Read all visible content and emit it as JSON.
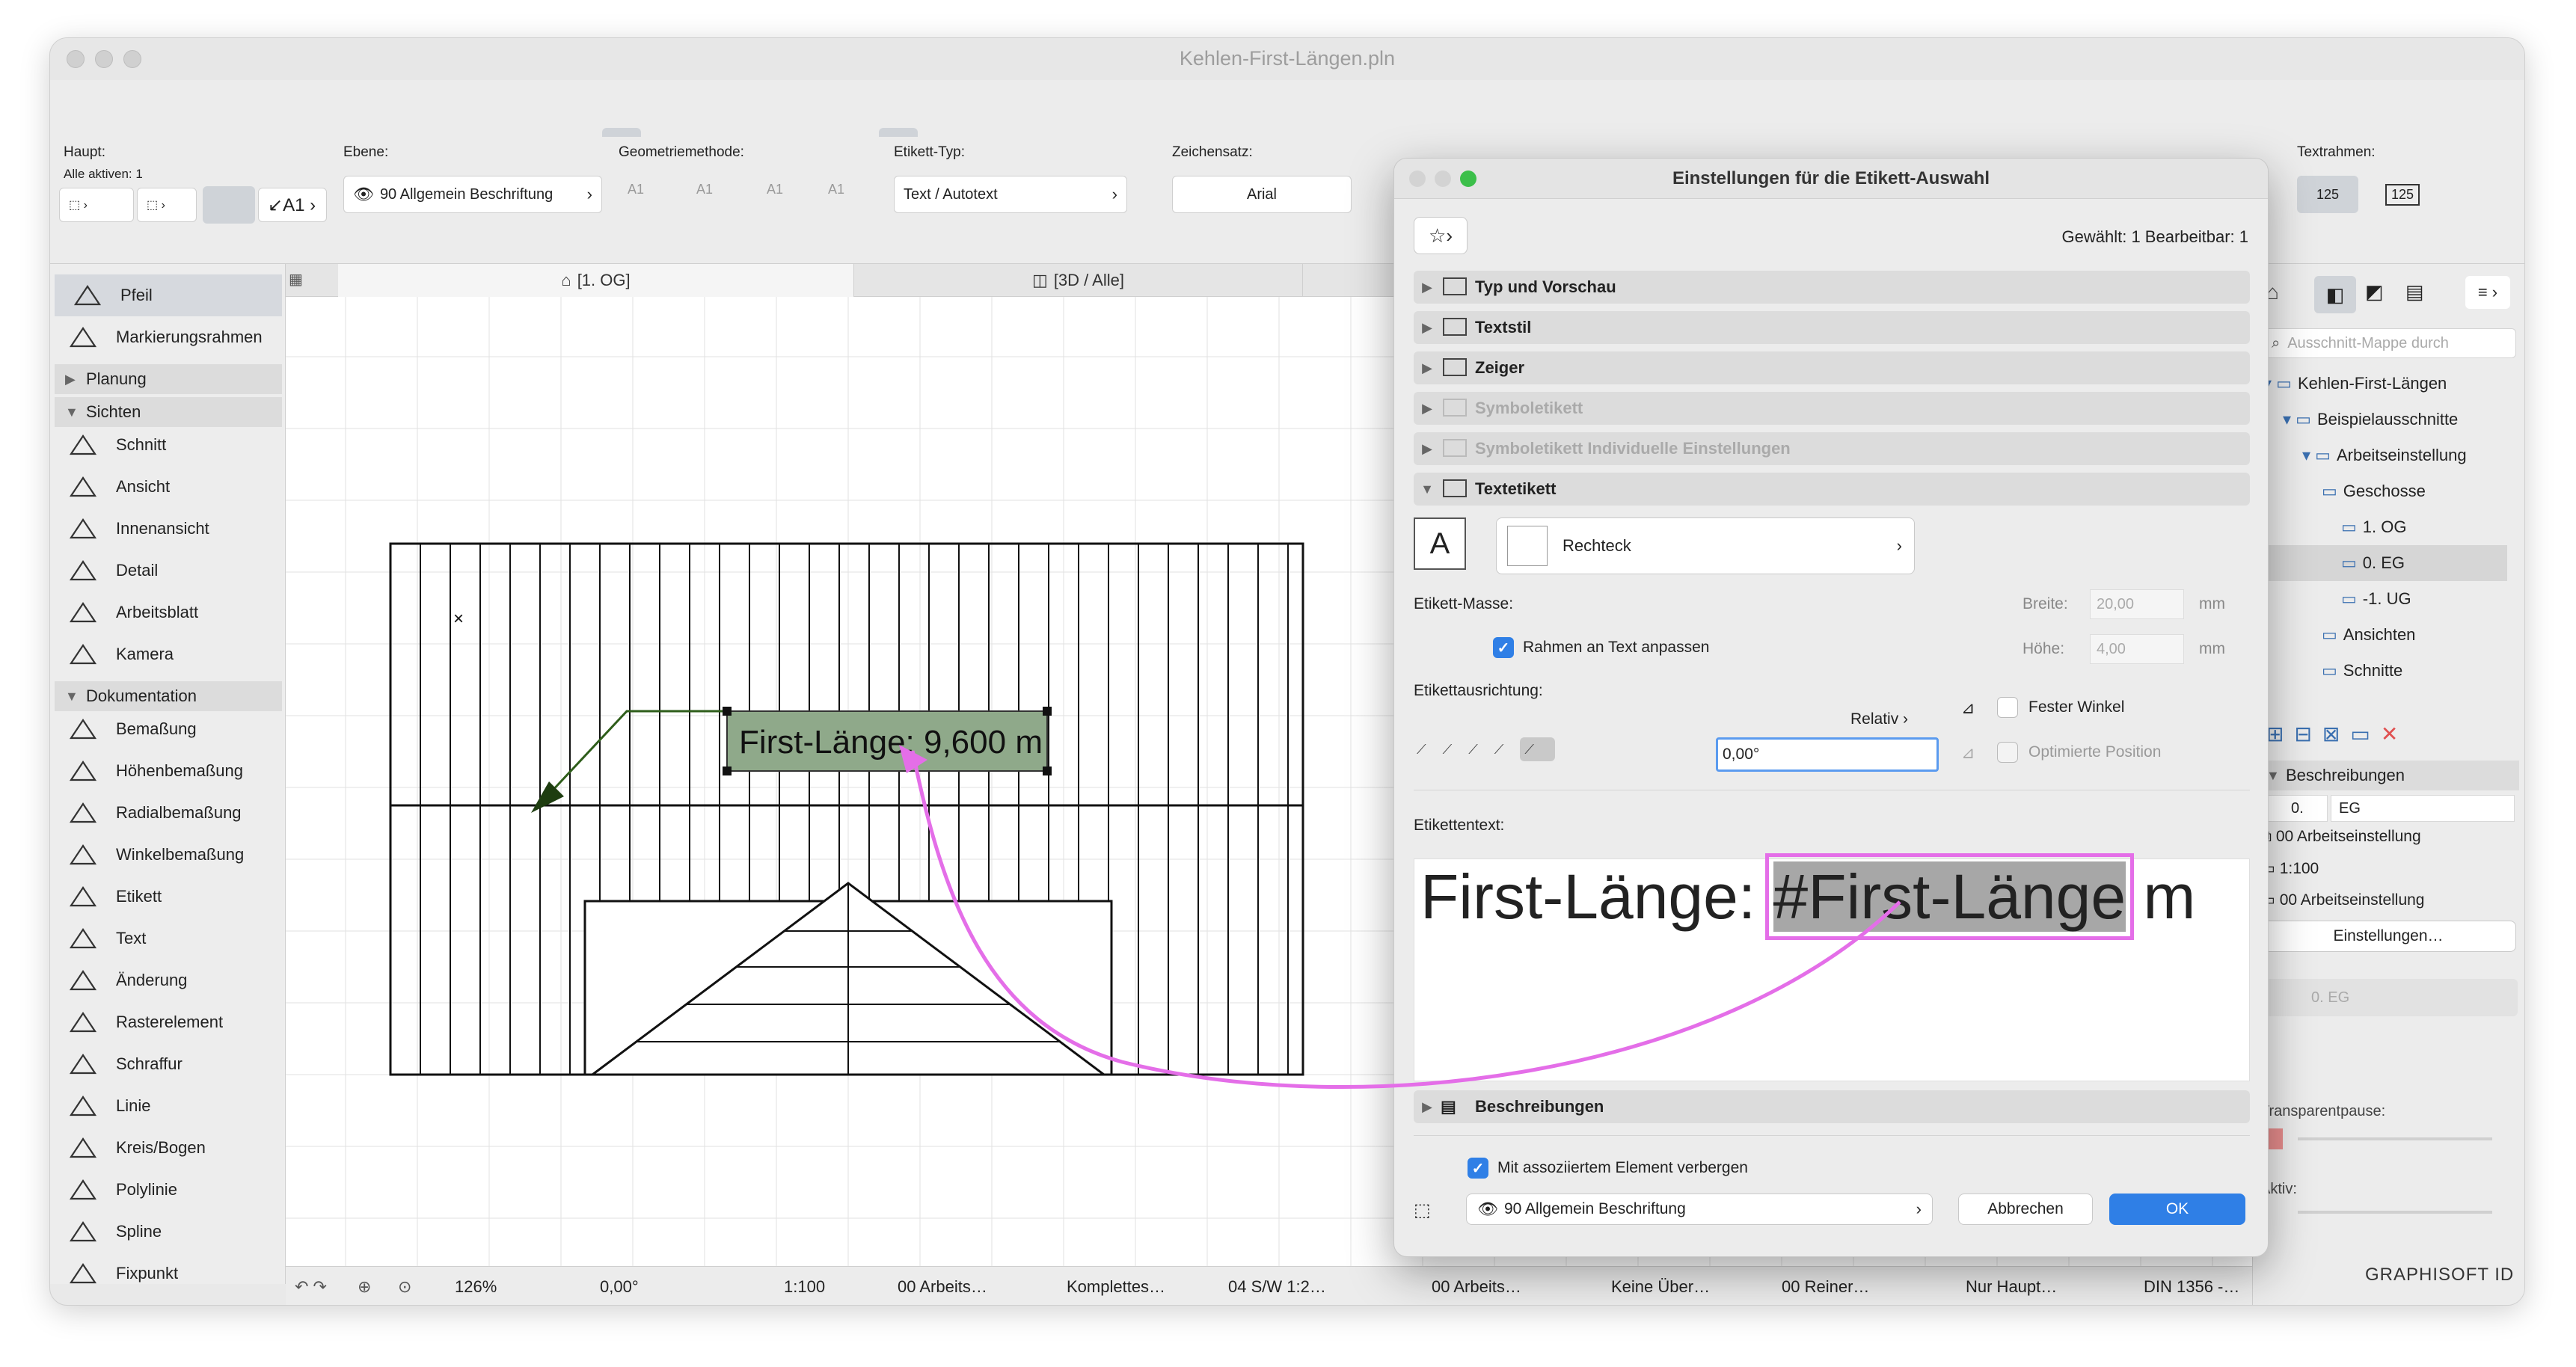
{
  "window": {
    "title": "Kehlen-First-Längen.pln"
  },
  "infobox": {
    "main_label": "Haupt:",
    "all_active": "Alle aktiven: 1",
    "layer_label": "Ebene:",
    "layer_value": "90 Allgemein Beschriftung",
    "geometry_label": "Geometriemethode:",
    "label_type_label": "Etikett-Typ:",
    "label_type_value": "Text / Autotext",
    "font_label": "Zeichensatz:",
    "font_value": "Arial",
    "textframe_label": "Textrahmen:",
    "textframe_a": "125",
    "textframe_b": "125"
  },
  "tabs": [
    {
      "label": "[1. OG]"
    },
    {
      "label": "[3D / Alle]"
    }
  ],
  "toolbox": {
    "items": [
      {
        "name": "Pfeil",
        "icon": "arrow-pointer-icon",
        "selected": true
      },
      {
        "name": "Markierungsrahmen",
        "icon": "marquee-icon"
      },
      {
        "section": "Planung",
        "collapsed": true
      },
      {
        "section": "Sichten",
        "collapsed": false
      },
      {
        "name": "Schnitt",
        "icon": "section-icon"
      },
      {
        "name": "Ansicht",
        "icon": "elevation-icon"
      },
      {
        "name": "Innenansicht",
        "icon": "interior-elevation-icon"
      },
      {
        "name": "Detail",
        "icon": "detail-icon"
      },
      {
        "name": "Arbeitsblatt",
        "icon": "worksheet-icon"
      },
      {
        "name": "Kamera",
        "icon": "camera-icon"
      },
      {
        "section": "Dokumentation",
        "collapsed": false
      },
      {
        "name": "Bemaßung",
        "icon": "dimension-icon"
      },
      {
        "name": "Höhenbemaßung",
        "icon": "level-dimension-icon"
      },
      {
        "name": "Radialbemaßung",
        "icon": "radial-dimension-icon"
      },
      {
        "name": "Winkelbemaßung",
        "icon": "angle-dimension-icon"
      },
      {
        "name": "Etikett",
        "icon": "label-icon"
      },
      {
        "name": "Text",
        "icon": "text-icon"
      },
      {
        "name": "Änderung",
        "icon": "change-icon"
      },
      {
        "name": "Rasterelement",
        "icon": "grid-element-icon"
      },
      {
        "name": "Schraffur",
        "icon": "fill-icon"
      },
      {
        "name": "Linie",
        "icon": "line-icon"
      },
      {
        "name": "Kreis/Bogen",
        "icon": "circle-icon"
      },
      {
        "name": "Polylinie",
        "icon": "polyline-icon"
      },
      {
        "name": "Spline",
        "icon": "spline-icon"
      },
      {
        "name": "Fixpunkt",
        "icon": "hotspot-icon"
      }
    ]
  },
  "canvas": {
    "label_text": "First-Länge: 9,600 m",
    "accent": "#e46ee8",
    "label_bg": "#8fa98a"
  },
  "statusbar": {
    "zoom": "126%",
    "angle": "0,00°",
    "scale": "1:100",
    "items": [
      "00 Arbeits…",
      "Komplettes…",
      "04 S/W 1:2…",
      "00 Arbeits…",
      "Keine Über…",
      "00 Reiner…",
      "Nur Haupt…",
      "DIN 1356 -…"
    ]
  },
  "navigator": {
    "search_placeholder": "Ausschnitt-Mappe durch",
    "tree": [
      {
        "label": "Kehlen-First-Längen",
        "level": 0
      },
      {
        "label": "Beispielausschnitte",
        "level": 1
      },
      {
        "label": "Arbeitseinstellung",
        "level": 2
      },
      {
        "label": "Geschosse",
        "level": 3
      },
      {
        "label": "1. OG",
        "level": 4
      },
      {
        "label": "0. EG",
        "level": 4,
        "selected": true
      },
      {
        "label": "-1. UG",
        "level": 4
      },
      {
        "label": "Ansichten",
        "level": 3
      },
      {
        "label": "Schnitte",
        "level": 3
      }
    ],
    "desc_header": "Beschreibungen",
    "id_num": "0.",
    "id_name": "EG",
    "setting1": "00 Arbeitseinstellung",
    "scale": "1:100",
    "setting2": "00 Arbeitseinstellung",
    "settings_btn": "Einstellungen…",
    "layer_field": "0. EG",
    "transparent_label": "Transparentpause:",
    "active_label": "Aktiv:",
    "brand": "GRAPHISOFT ID"
  },
  "dialog": {
    "title": "Einstellungen für die Etikett-Auswahl",
    "selected_info": "Gewählt: 1 Bearbeitbar: 1",
    "sections": [
      {
        "label": "Typ und Vorschau",
        "icon": "type-preview-icon",
        "disabled": false
      },
      {
        "label": "Textstil",
        "icon": "text-style-icon",
        "disabled": false
      },
      {
        "label": "Zeiger",
        "icon": "pointer-icon",
        "disabled": false
      },
      {
        "label": "Symboletikett",
        "icon": "symbol-label-icon",
        "disabled": true
      },
      {
        "label": "Symboletikett Individuelle Einstellungen",
        "icon": "symbol-settings-icon",
        "disabled": true
      },
      {
        "label": "Textetikett",
        "icon": "text-label-icon",
        "disabled": false,
        "open": true
      }
    ],
    "frame_shape": "Rechteck",
    "label_dims": "Etikett-Masse:",
    "width_label": "Breite:",
    "width_value": "20,00",
    "height_label": "Höhe:",
    "height_value": "4,00",
    "unit": "mm",
    "fit_frame": "Rahmen an Text anpassen",
    "orientation": "Etikettausrichtung:",
    "relative": "Relativ",
    "angle_value": "0,00°",
    "fixed_angle": "Fester Winkel",
    "optimized": "Optimierte Position",
    "text_label": "Etikettentext:",
    "text_prefix": "First-Länge: ",
    "text_autotext": "#First-Länge",
    "text_suffix": " m",
    "descriptions": "Beschreibungen",
    "hide_assoc": "Mit assoziiertem Element verbergen",
    "layer": "90 Allgemein Beschriftung",
    "cancel": "Abbrechen",
    "ok": "OK"
  }
}
